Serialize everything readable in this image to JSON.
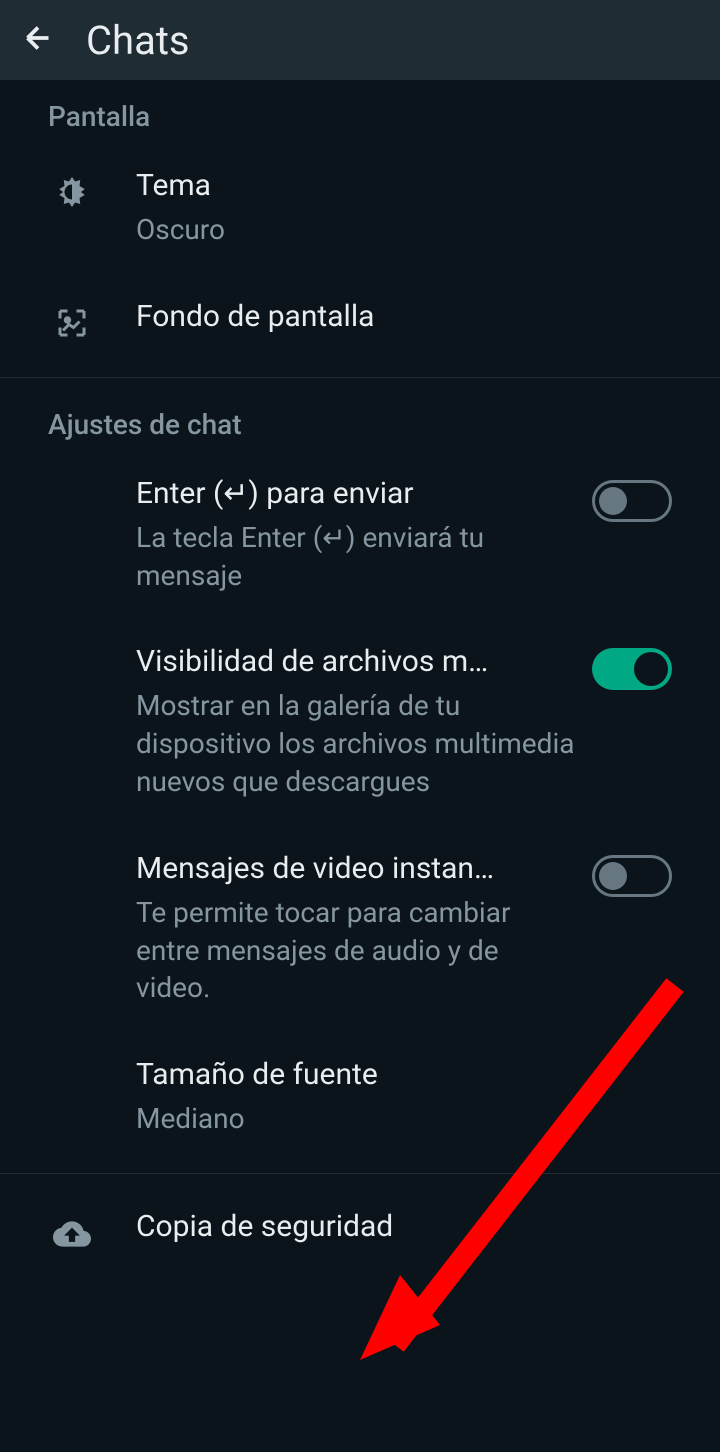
{
  "header": {
    "title": "Chats"
  },
  "sections": {
    "display": {
      "header": "Pantalla",
      "theme": {
        "title": "Tema",
        "value": "Oscuro"
      },
      "wallpaper": {
        "title": "Fondo de pantalla"
      }
    },
    "chat": {
      "header": "Ajustes de chat",
      "enterToSend": {
        "title": "Enter (↵) para enviar",
        "subtitle": "La tecla Enter (↵) enviará tu mensaje",
        "enabled": false
      },
      "mediaVisibility": {
        "title": "Visibilidad de archivos m…",
        "subtitle": "Mostrar en la galería de tu dispositivo los archivos multimedia nuevos que descargues",
        "enabled": true
      },
      "instantVideo": {
        "title": "Mensajes de video instan…",
        "subtitle": "Te permite tocar para cambiar entre mensajes de audio y de video.",
        "enabled": false
      },
      "fontSize": {
        "title": "Tamaño de fuente",
        "value": "Mediano"
      }
    },
    "backup": {
      "title": "Copia de seguridad"
    }
  }
}
